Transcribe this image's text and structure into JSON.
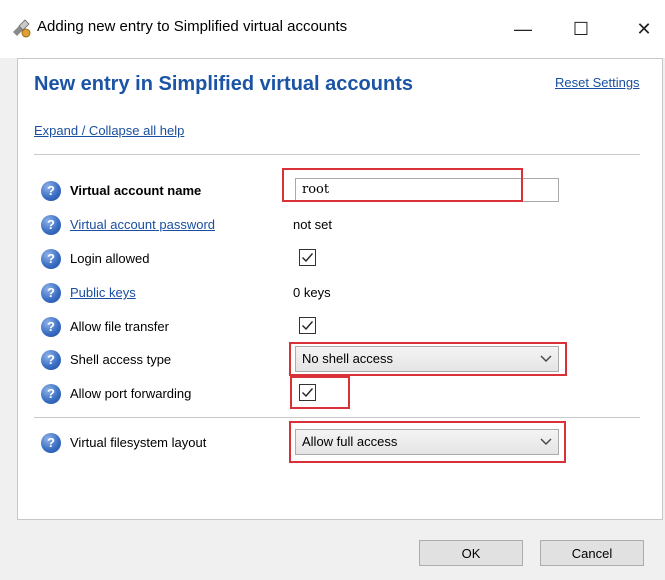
{
  "window": {
    "title": "Adding new entry to Simplified virtual accounts",
    "minimize": "—",
    "maximize": "☐",
    "close": "✕"
  },
  "header": {
    "title": "New entry in Simplified virtual accounts",
    "reset_link": "Reset Settings",
    "expand_link": "Expand / Collapse all help"
  },
  "fields": {
    "account_name": {
      "label": "Virtual account name",
      "value": "root"
    },
    "account_password": {
      "label": "Virtual account password",
      "value": "not set"
    },
    "login_allowed": {
      "label": "Login allowed",
      "checked": true
    },
    "public_keys": {
      "label": "Public keys",
      "value": "0 keys"
    },
    "file_transfer": {
      "label": "Allow file transfer",
      "checked": true
    },
    "shell_access": {
      "label": "Shell access type",
      "value": "No shell access"
    },
    "port_forwarding": {
      "label": "Allow port forwarding",
      "checked": true
    },
    "filesystem_layout": {
      "label": "Virtual filesystem layout",
      "value": "Allow full access"
    }
  },
  "help_icon_glyph": "?",
  "buttons": {
    "ok": "OK",
    "cancel": "Cancel"
  },
  "colors": {
    "accent": "#1b54a5",
    "highlight": "#d9303a",
    "link": "#1a4fa0"
  }
}
